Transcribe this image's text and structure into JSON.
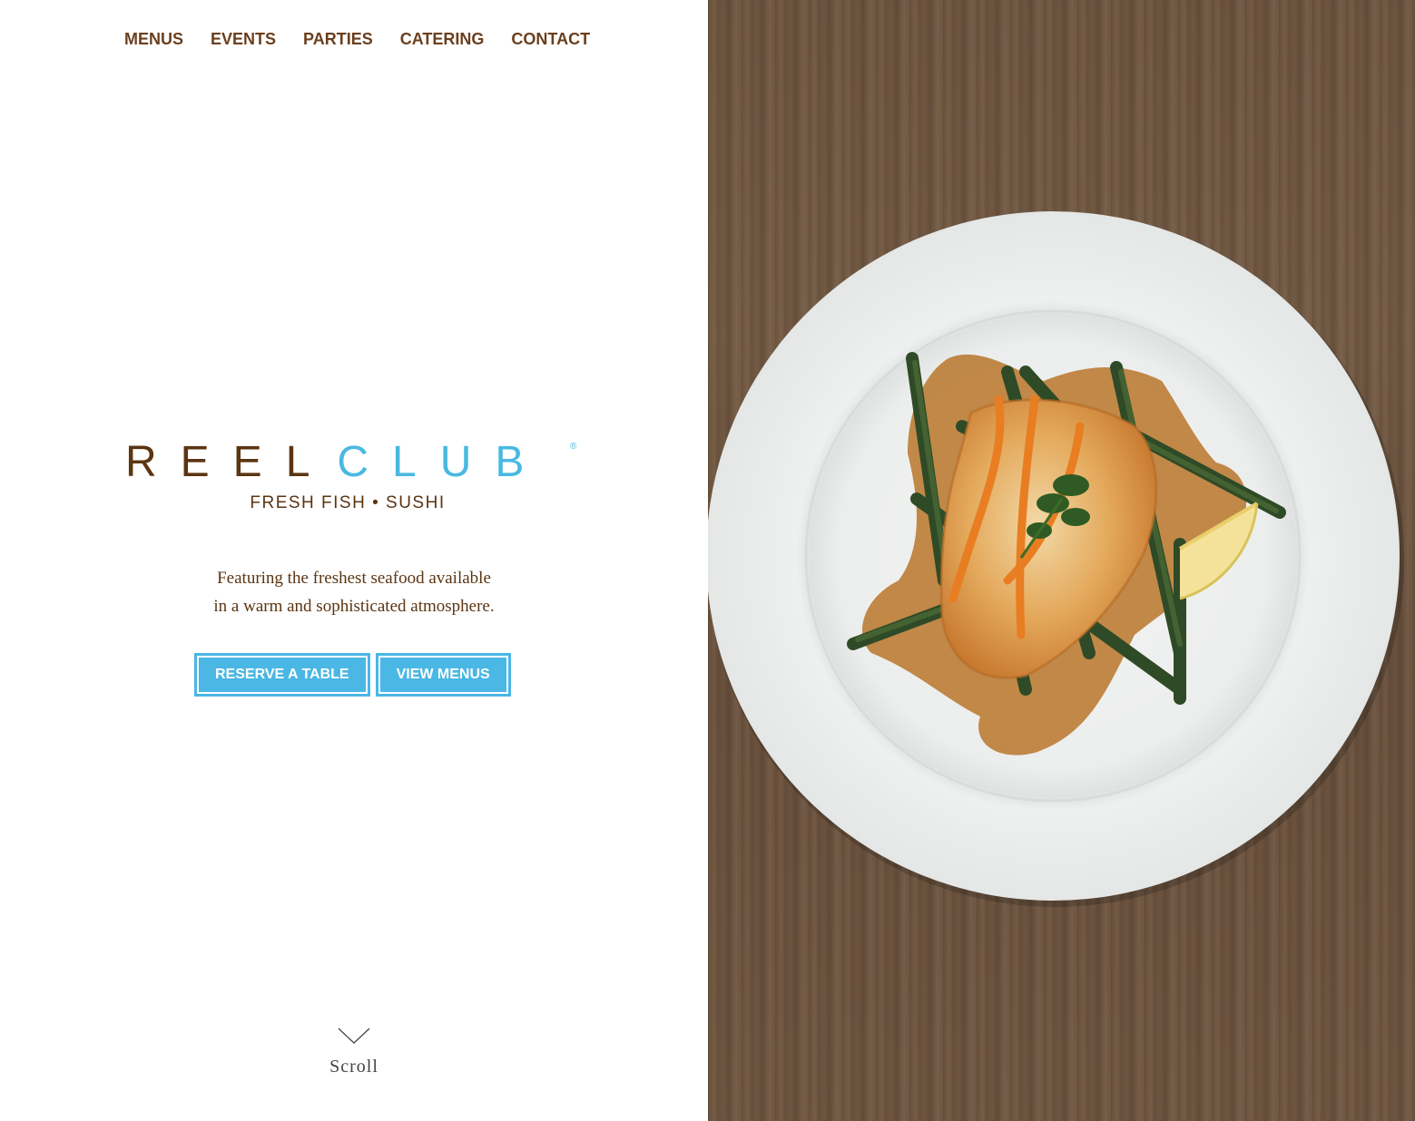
{
  "nav": {
    "items": [
      {
        "label": "MENUS"
      },
      {
        "label": "EVENTS"
      },
      {
        "label": "PARTIES"
      },
      {
        "label": "CATERING"
      },
      {
        "label": "CONTACT"
      }
    ]
  },
  "logo": {
    "word_reel": "REEL",
    "word_club": "CLUB",
    "registered": "®",
    "tagline": "FRESH FISH • SUSHI"
  },
  "intro": {
    "line1": "Featuring the freshest seafood available",
    "line2": "in a warm and sophisticated atmosphere."
  },
  "buttons": {
    "reserve": "RESERVE A TABLE",
    "menus": "VIEW MENUS"
  },
  "scroll": {
    "label": "Scroll",
    "icon": "chevron-down-icon"
  },
  "colors": {
    "brown": "#5b3512",
    "nav_brown": "#6b3f1d",
    "blue": "#4ab7e4",
    "wood": "#6e5540",
    "plate": "#eef0ef"
  }
}
